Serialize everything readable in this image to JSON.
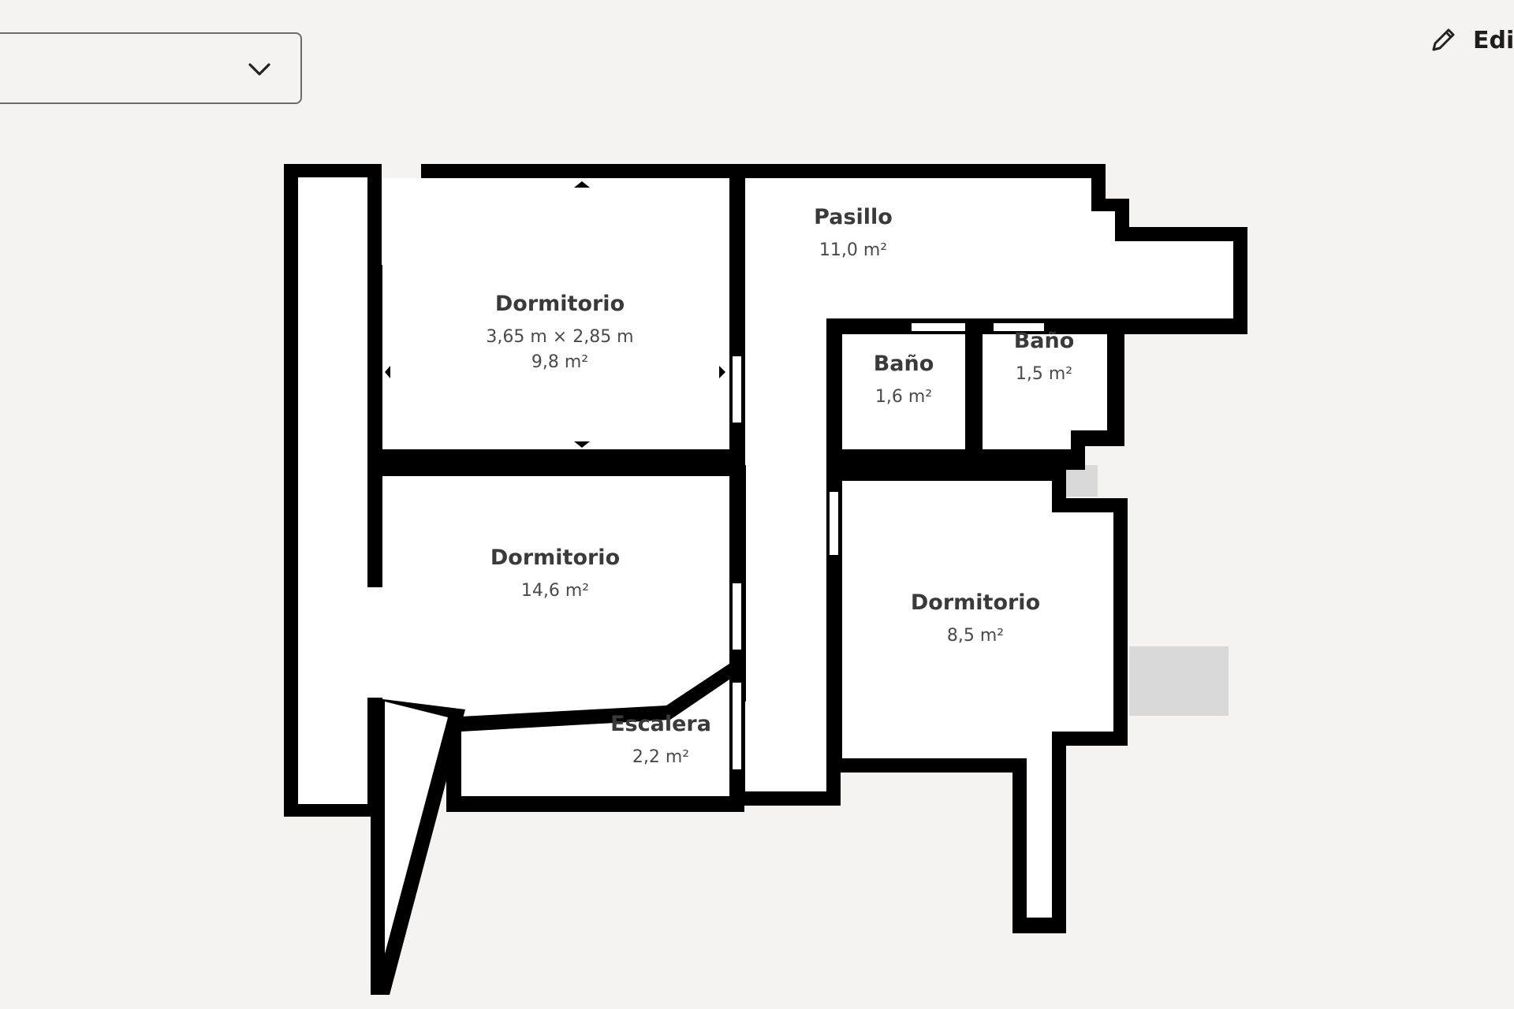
{
  "toolbar": {
    "floor_selector": {
      "value": ""
    },
    "edit": {
      "label": "Edi",
      "icon": "pencil-icon"
    }
  },
  "floor_plan": {
    "rooms": [
      {
        "name": "Dormitorio",
        "dimensions": "3,65 m × 2,85 m",
        "area": "9,8 m²"
      },
      {
        "name": "Pasillo",
        "area": "11,0 m²"
      },
      {
        "name": "Baño",
        "area": "1,6 m²"
      },
      {
        "name": "Baño",
        "area": "1,5 m²"
      },
      {
        "name": "Dormitorio",
        "area": "14,6 m²"
      },
      {
        "name": "Dormitorio",
        "area": "8,5 m²"
      },
      {
        "name": "Escalera",
        "area": "2,2 m²"
      }
    ]
  },
  "colors": {
    "background": "#f4f3f1",
    "wall": "#000000",
    "room": "#ffffff",
    "outside": "#d9d9d9"
  }
}
